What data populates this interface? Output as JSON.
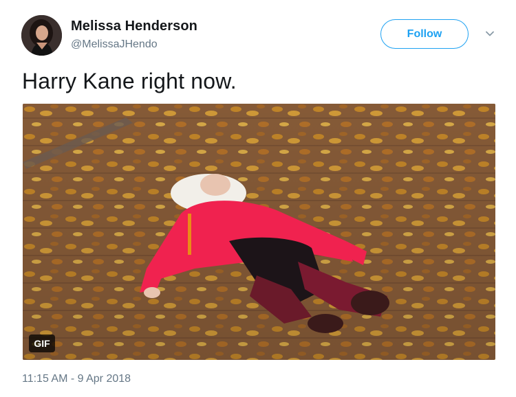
{
  "author": {
    "display_name": "Melissa Henderson",
    "handle": "@MelissaJHendo"
  },
  "actions": {
    "follow_label": "Follow",
    "more_icon": "chevron-down-icon"
  },
  "tweet": {
    "text": "Harry Kane right now.",
    "media_badge": "GIF",
    "timestamp": "11:15 AM - 9 Apr 2018"
  },
  "colors": {
    "accent": "#1da1f2",
    "text_primary": "#14171a",
    "text_secondary": "#657786"
  }
}
